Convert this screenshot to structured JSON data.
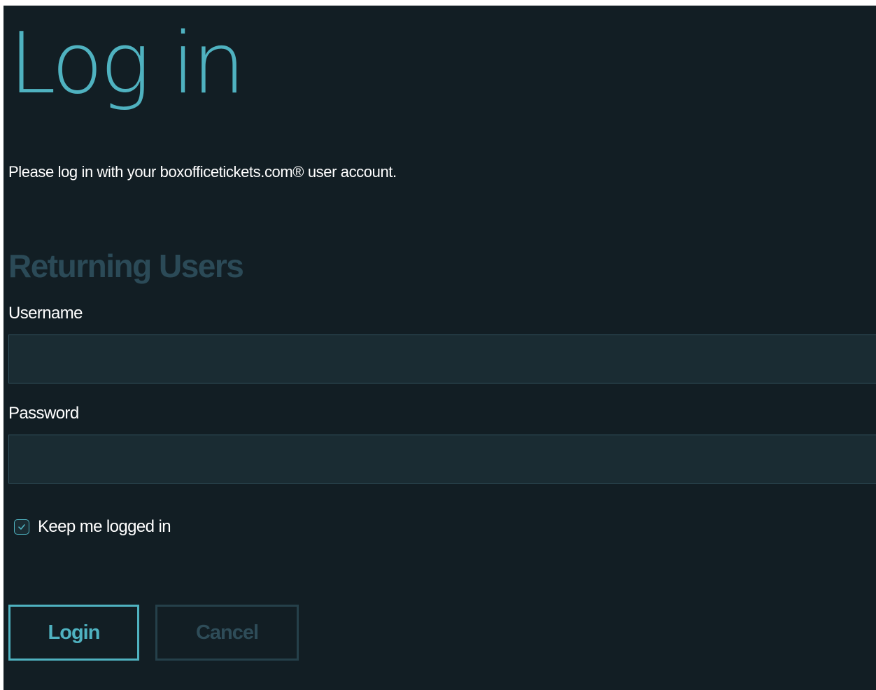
{
  "page": {
    "title": "Log in",
    "intro_text": "Please log in with your boxofficetickets.com® user account."
  },
  "form": {
    "section_heading": "Returning Users",
    "username": {
      "label": "Username",
      "value": "",
      "placeholder": ""
    },
    "password": {
      "label": "Password",
      "value": "",
      "placeholder": ""
    },
    "keep_logged_in": {
      "label": "Keep me logged in",
      "checked": true
    },
    "buttons": {
      "login_label": "Login",
      "cancel_label": "Cancel"
    }
  },
  "colors": {
    "background": "#121e24",
    "accent": "#4fb2c0",
    "input_background": "#1a2c33",
    "input_border": "#33535e",
    "muted_heading": "#2b4a57",
    "disabled_button": "#25404a"
  },
  "icons": {
    "checkbox_mark": "check-icon"
  }
}
